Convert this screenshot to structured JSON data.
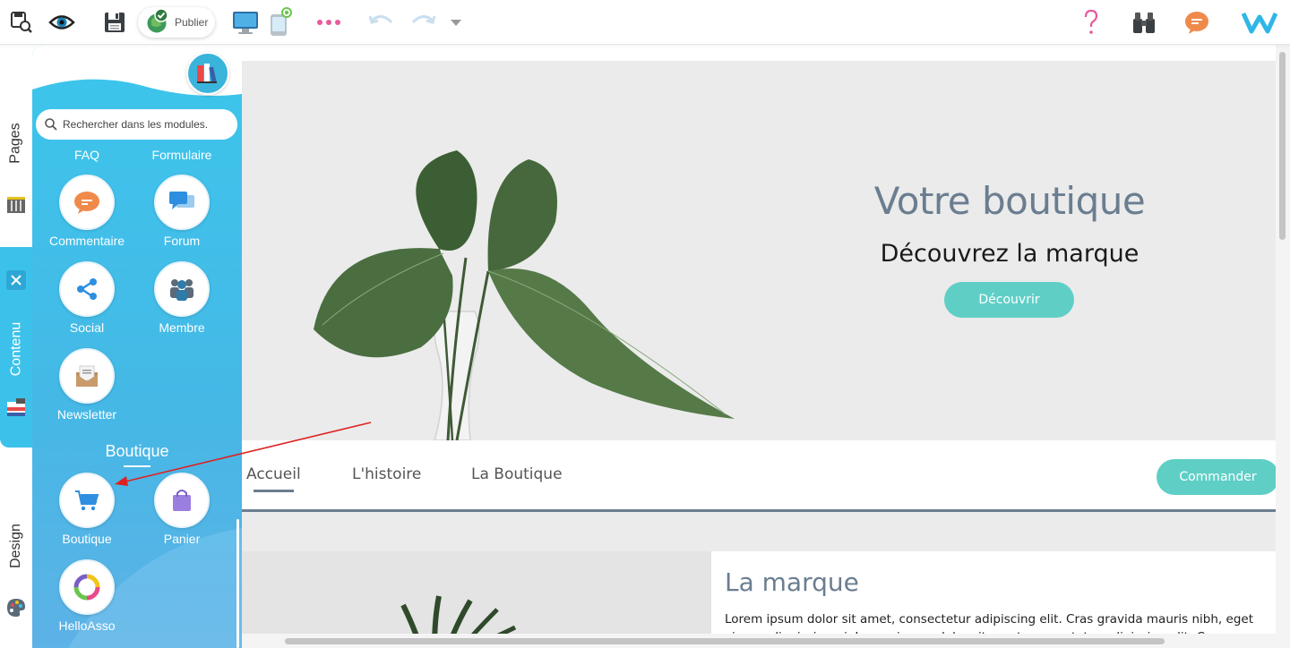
{
  "toolbar": {
    "publish_label": "Publier",
    "icons": [
      "preview-search-icon",
      "eye-icon",
      "save-icon",
      "publish-check-icon",
      "desktop-icon",
      "mobile-icon",
      "more-icon",
      "undo-icon",
      "redo-icon",
      "dropdown-icon",
      "help-icon",
      "binoculars-icon",
      "chat-icon",
      "brand-logo-icon"
    ]
  },
  "rail": {
    "tabs": [
      "Pages",
      "Contenu",
      "Design"
    ]
  },
  "panel": {
    "search_placeholder": "Rechercher dans les modules.",
    "cut_labels": [
      "FAQ",
      "Formulaire"
    ],
    "modules": [
      {
        "label": "Commentaire",
        "icon": "comment-icon"
      },
      {
        "label": "Forum",
        "icon": "forum-icon"
      },
      {
        "label": "Social",
        "icon": "share-icon"
      },
      {
        "label": "Membre",
        "icon": "members-icon"
      },
      {
        "label": "Newsletter",
        "icon": "newsletter-icon"
      }
    ],
    "shop_section_title": "Boutique",
    "shop_modules": [
      {
        "label": "Boutique",
        "icon": "cart-icon"
      },
      {
        "label": "Panier",
        "icon": "bag-icon"
      },
      {
        "label": "HelloAsso",
        "icon": "helloasso-icon"
      }
    ]
  },
  "hero": {
    "title": "Votre boutique",
    "subtitle": "Découvrez la marque",
    "cta": "Découvrir"
  },
  "nav": {
    "items": [
      "Accueil",
      "L'histoire",
      "La Boutique"
    ],
    "active": "Accueil",
    "order_button": "Commander"
  },
  "section": {
    "title": "La marque",
    "body": "Lorem ipsum dolor sit amet, consectetur adipiscing elit. Cras gravida mauris nibh, eget viverra dignissim mi. Lorem ipsum dolor sit amet, consectetur adipiscing elit. Cras"
  },
  "colors": {
    "panel": "#3cc6ec",
    "teal_button": "#5fcfc6",
    "heading": "#6b7d90",
    "annotation_arrow": "#e02020"
  }
}
